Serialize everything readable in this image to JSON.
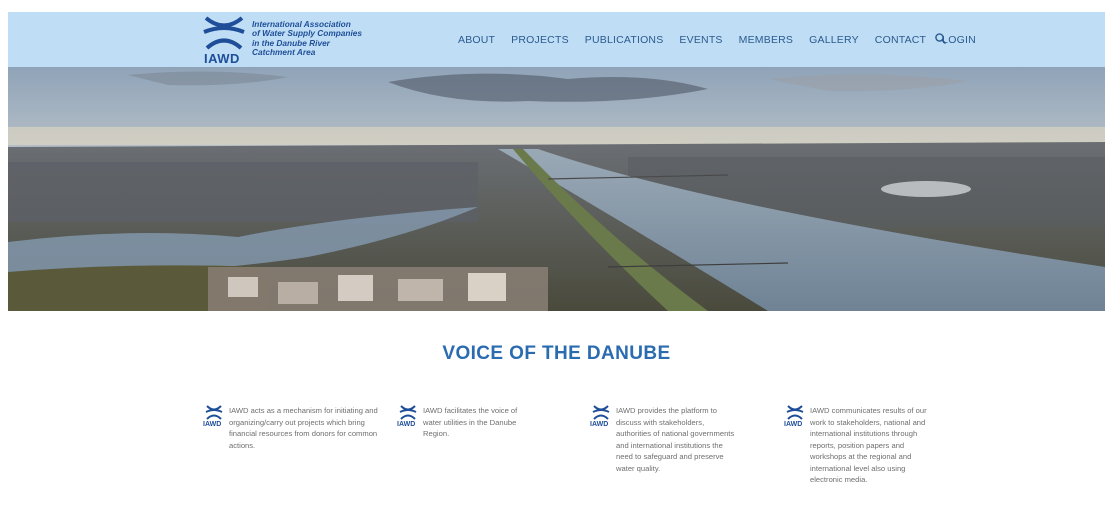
{
  "header": {
    "logo_abbr": "IAWD",
    "logo_lines": [
      "International Association",
      "of Water Supply Companies",
      "in the Danube River",
      "Catchment Area"
    ],
    "nav": [
      "ABOUT",
      "PROJECTS",
      "PUBLICATIONS",
      "EVENTS",
      "MEMBERS",
      "GALLERY",
      "CONTACT",
      "LOGIN"
    ],
    "search_icon": "search-icon",
    "colors": {
      "header_bg": "#bfdef5",
      "brand": "#1f4e99",
      "nav_text": "#2a5a8f"
    }
  },
  "hero": {
    "image": "aerial-view-danube-river-vienna"
  },
  "main": {
    "title": "VOICE OF THE DANUBE",
    "title_color": "#2b6bb0",
    "features": [
      {
        "abbr": "IAWD",
        "text": "IAWD acts as a mechanism for initiating and organizing/carry out projects which bring financial resources from donors for common actions."
      },
      {
        "abbr": "IAWD",
        "text": "IAWD facilitates the voice of water utilities in the Danube Region."
      },
      {
        "abbr": "IAWD",
        "text": "IAWD provides the platform to discuss with stakeholders, authorities of national governments and international institutions the need to safeguard and preserve water quality."
      },
      {
        "abbr": "IAWD",
        "text": "IAWD communicates results of our work to stakeholders, national and international institutions through reports, position papers and workshops at the regional and international level also using electronic media."
      }
    ]
  }
}
